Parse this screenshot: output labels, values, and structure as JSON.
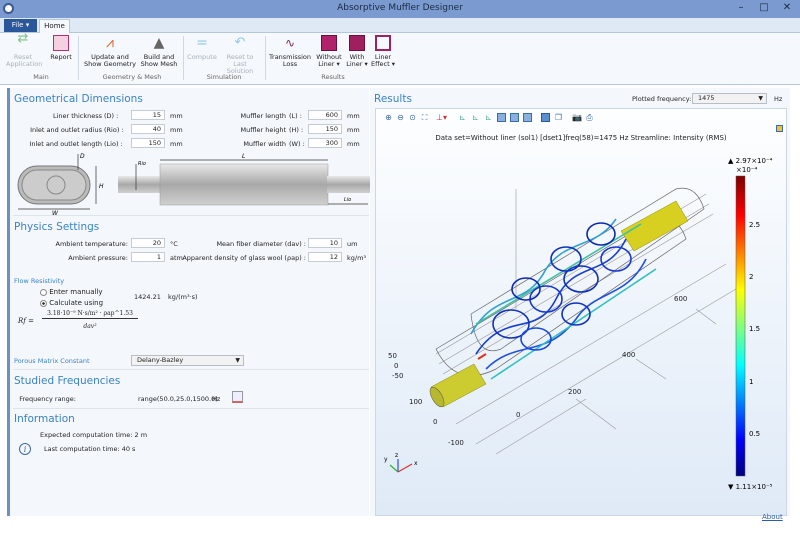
{
  "window": {
    "title": "Absorptive Muffler Designer",
    "controls": [
      "–",
      "□",
      "✕"
    ]
  },
  "ribbon": {
    "file_tab": "File ▾",
    "home_tab": "Home",
    "buttons": {
      "reset_app": "Reset Application",
      "report": "Report",
      "update_geom": "Update and Show Geometry",
      "build_mesh": "Build and Show Mesh",
      "compute": "Compute",
      "reset_solution": "Reset to Last Solution",
      "transmission_loss": "Transmission Loss",
      "without_liner": "Without Liner ▾",
      "with_liner": "With Liner ▾",
      "liner_effect": "Liner Effect ▾"
    },
    "groups": {
      "main": "Main",
      "geometry": "Geometry & Mesh",
      "simulation": "Simulation",
      "results": "Results"
    }
  },
  "geom": {
    "title": "Geometrical Dimensions",
    "fields": [
      {
        "label": "Liner thickness",
        "sym": "(D) :",
        "value": "15",
        "unit": "mm"
      },
      {
        "label": "Inlet and outlet radius",
        "sym": "(Rio) :",
        "value": "40",
        "unit": "mm"
      },
      {
        "label": "Inlet and outlet length",
        "sym": "(Lio) :",
        "value": "150",
        "unit": "mm"
      },
      {
        "label": "Muffler length",
        "sym": "(L) :",
        "value": "600",
        "unit": "mm"
      },
      {
        "label": "Muffler height",
        "sym": "(H) :",
        "value": "150",
        "unit": "mm"
      },
      {
        "label": "Muffler width",
        "sym": "(W) :",
        "value": "300",
        "unit": "mm"
      }
    ],
    "diagram_labels": {
      "d": "D",
      "h": "H",
      "w": "W",
      "l": "L",
      "rio": "Rio",
      "lio": "Lio"
    }
  },
  "physics": {
    "title": "Physics Settings",
    "fields": [
      {
        "label": "Ambient temperature:",
        "value": "20",
        "unit": "°C"
      },
      {
        "label": "Ambient pressure:",
        "value": "1",
        "unit": "atm"
      },
      {
        "label": "Mean fiber diameter  (dav) :",
        "value": "10",
        "unit": "um"
      },
      {
        "label": "Apparent density of glass wool  (ρap) :",
        "value": "12",
        "unit": "kg/m³"
      }
    ],
    "flow_resistivity": {
      "title": "Flow Resistivity",
      "opt_manual": "Enter manually",
      "opt_calc": "Calculate using",
      "selected": "Calculate using",
      "value": "1424.21",
      "unit": "kg/(m³·s)",
      "formula_lhs": "Rf =",
      "formula_num": "3.18·10⁻⁹ N·s/m² · ρap^1.53",
      "formula_den": "dav²"
    },
    "porous": {
      "label": "Porous Matrix Constant",
      "value": "Delany-Bazley"
    }
  },
  "freq": {
    "title": "Studied Frequencies",
    "label": "Frequency range:",
    "value": "range(50.0,25.0,1500.0)",
    "unit": "Hz"
  },
  "info": {
    "title": "Information",
    "expected": "Expected computation time:  2 m",
    "last": "Last computation time: 40 s"
  },
  "results": {
    "title": "Results",
    "plotted_label": "Plotted frequency:",
    "plotted_value": "1475",
    "plotted_unit": "Hz",
    "plot_title": "Data set=Without liner (sol1) [dset1]freq(58)=1475 Hz   Streamline: Intensity (RMS)",
    "colorbar": {
      "max": "▲ 2.97×10⁻⁴",
      "scale": "×10⁻⁴",
      "min": "▼ 1.11×10⁻⁵",
      "ticks": [
        "2.5",
        "2",
        "1.5",
        "1",
        "0.5"
      ]
    },
    "axis_labels": {
      "a600": "600",
      "a400": "400",
      "a200": "200",
      "a0": "0",
      "z50": "50",
      "z0": "0",
      "zm50": "-50",
      "y100": "100",
      "y0": "0",
      "ym100": "-100"
    },
    "triad": {
      "x": "x",
      "y": "y",
      "z": "z"
    }
  },
  "footer": {
    "about": "About"
  }
}
